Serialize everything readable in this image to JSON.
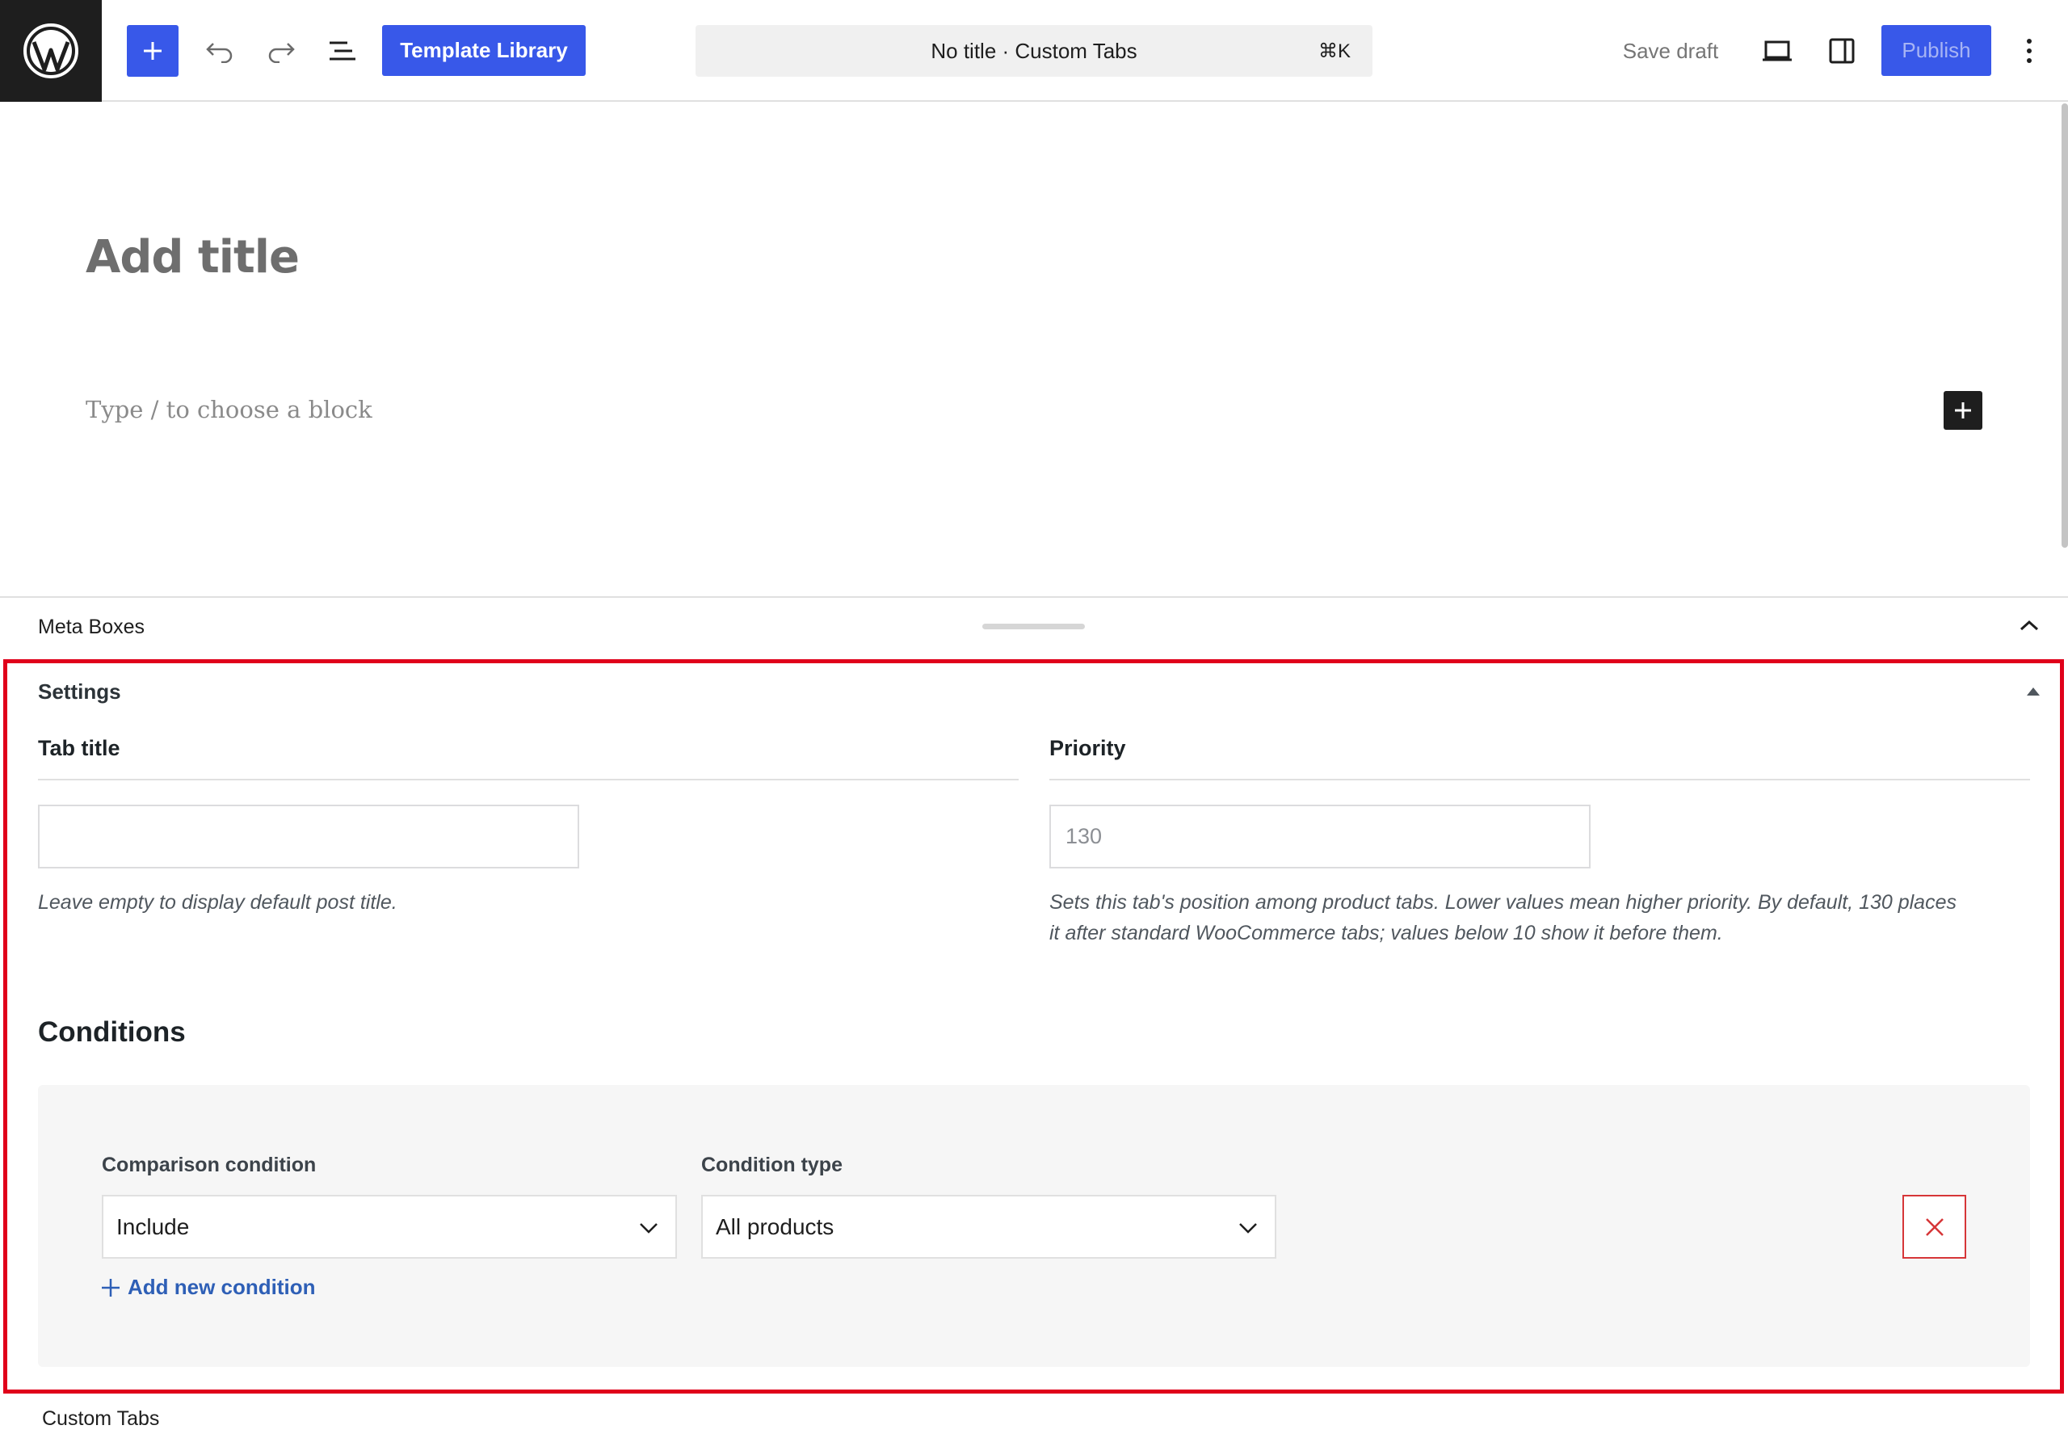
{
  "toolbar": {
    "add_block_icon": "plus-icon",
    "undo_icon": "undo-icon",
    "redo_icon": "redo-icon",
    "list_view_icon": "list-view-icon",
    "template_library_label": "Template Library",
    "command_title": "No title · Custom Tabs",
    "command_shortcut": "⌘K",
    "save_draft_label": "Save draft",
    "view_icon": "desktop-view-icon",
    "settings_icon": "sidebar-toggle-icon",
    "publish_label": "Publish",
    "more_icon": "kebab-menu-icon"
  },
  "editor": {
    "title_placeholder": "Add title",
    "block_placeholder": "Type / to choose a block"
  },
  "meta_boxes": {
    "title": "Meta Boxes"
  },
  "settings": {
    "title": "Settings",
    "tab_title": {
      "label": "Tab title",
      "value": "",
      "help": "Leave empty to display default post title."
    },
    "priority": {
      "label": "Priority",
      "placeholder": "130",
      "help_line1": "Sets this tab's position among product tabs. Lower values mean higher priority. By default, 130 places",
      "help_line2": "it after standard WooCommerce tabs; values below 10 show it before them."
    },
    "conditions": {
      "title": "Conditions",
      "comparison_label": "Comparison condition",
      "comparison_value": "Include",
      "type_label": "Condition type",
      "type_value": "All products",
      "add_label": "Add new condition"
    }
  },
  "footer": {
    "label": "Custom Tabs"
  },
  "colors": {
    "accent": "#3858e9",
    "highlight_border": "#e0001a",
    "danger": "#d63638",
    "link": "#2e5fb6"
  }
}
